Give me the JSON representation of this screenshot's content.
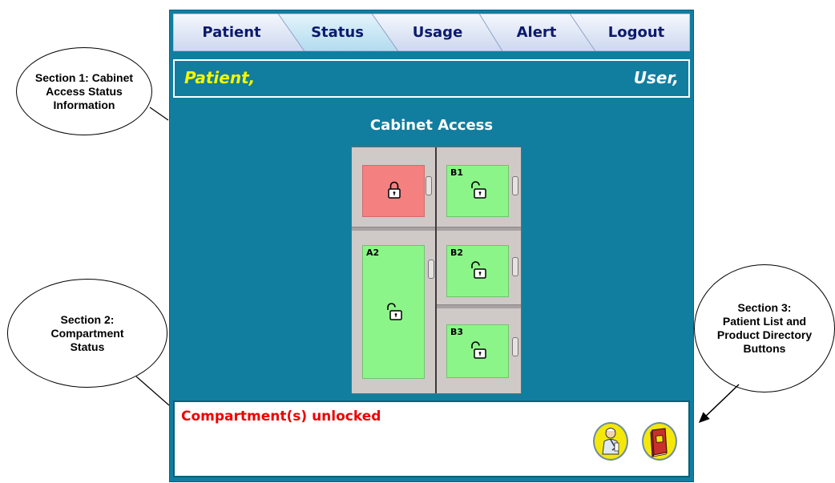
{
  "tabs": [
    {
      "label": "Patient",
      "active": false
    },
    {
      "label": "Status",
      "active": true
    },
    {
      "label": "Usage",
      "active": false
    },
    {
      "label": "Alert",
      "active": false
    },
    {
      "label": "Logout",
      "active": false
    }
  ],
  "header": {
    "patient_label": "Patient,",
    "user_label": "User,"
  },
  "cabinet": {
    "title": "Cabinet Access",
    "compartments": [
      {
        "id": "",
        "state": "locked"
      },
      {
        "id": "B1",
        "state": "unlocked"
      },
      {
        "id": "A2",
        "state": "unlocked"
      },
      {
        "id": "B2",
        "state": "unlocked"
      },
      {
        "id": "B3",
        "state": "unlocked"
      }
    ]
  },
  "status": {
    "message": "Compartment(s) unlocked"
  },
  "buttons": {
    "patient_list_icon": "patient-list-icon",
    "product_directory_icon": "product-directory-icon"
  },
  "annotations": {
    "section1": "Section 1: Cabinet\nAccess Status\nInformation",
    "section2": "Section 2:\nCompartment\nStatus",
    "section3": "Section 3:\nPatient List and\nProduct Directory\nButtons"
  },
  "colors": {
    "background": "#117ea0",
    "tab_bar": "#e2e9f7",
    "tab_active": "#c8e6f5",
    "patient_label": "#f5f500",
    "locked": "#f48080",
    "unlocked": "#8cf589",
    "status_text": "#ee0000"
  }
}
